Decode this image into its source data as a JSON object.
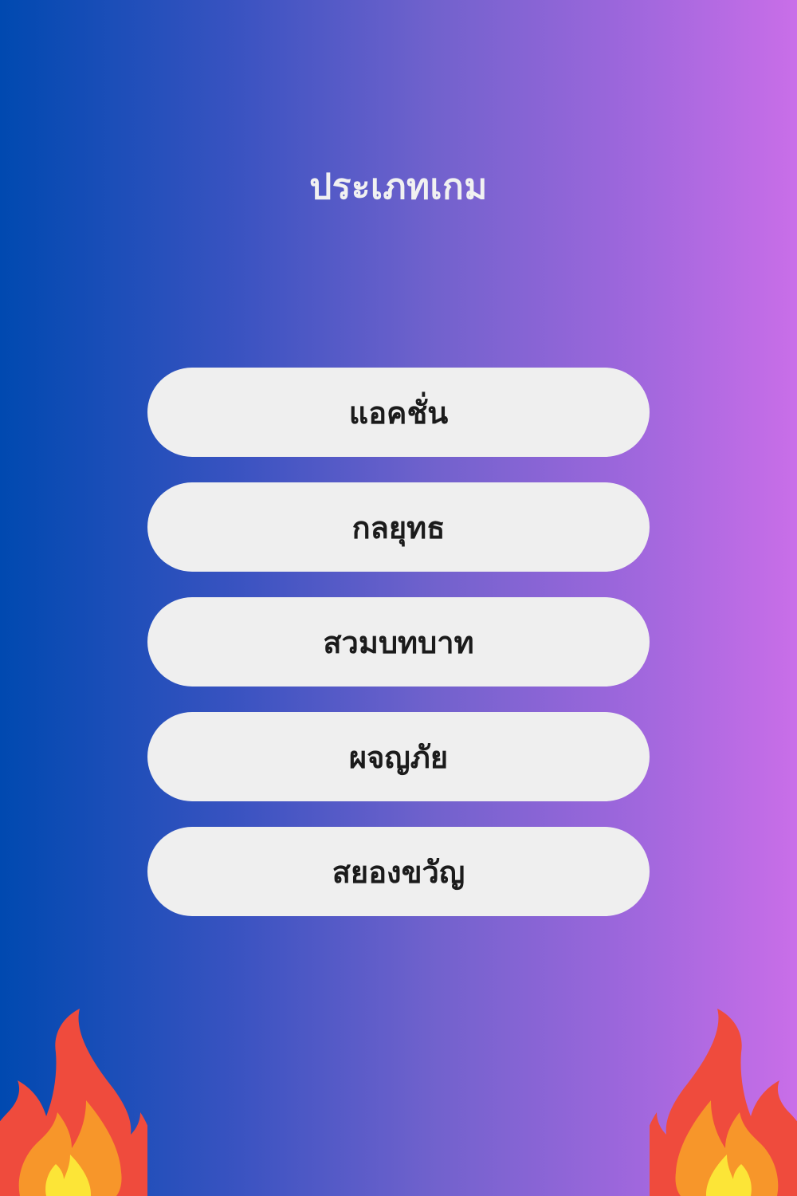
{
  "header": {
    "title": "ประเภทเกม"
  },
  "genres": [
    {
      "label": "แอคชั่น"
    },
    {
      "label": "กลยุทธ"
    },
    {
      "label": "สวมบทบาท"
    },
    {
      "label": "ผจญภัย"
    },
    {
      "label": "สยองขวัญ"
    }
  ],
  "theme": {
    "gradient_start": "#0049b0",
    "gradient_end": "#c96ee8",
    "button_bg": "#efefef",
    "button_text": "#1b1b1b",
    "title_text": "#f1f1f1",
    "flame_outer": "#ef4b3d",
    "flame_middle": "#f7962a",
    "flame_inner": "#fce537"
  },
  "decorations": {
    "left_icon": "fire-icon",
    "right_icon": "fire-icon"
  }
}
